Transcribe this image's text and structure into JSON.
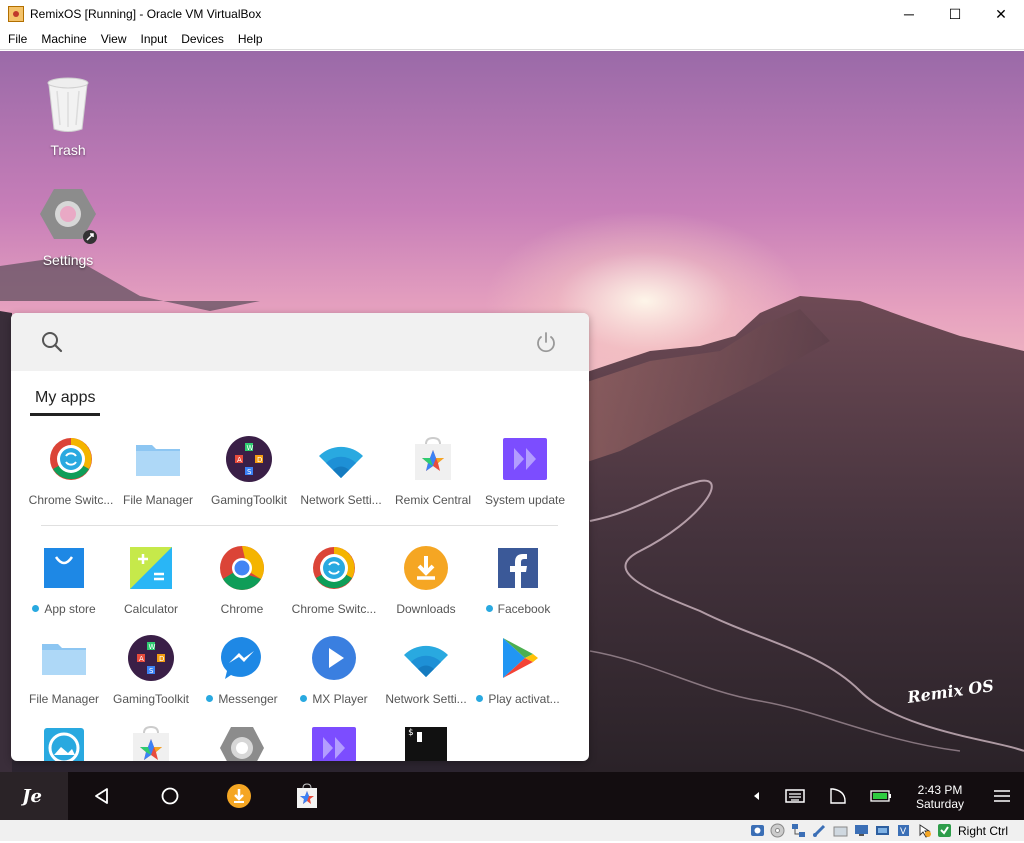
{
  "window": {
    "title": "RemixOS [Running] - Oracle VM VirtualBox",
    "controls": {
      "minimize": "─",
      "maximize": "☐",
      "close": "✕"
    }
  },
  "menu": [
    "File",
    "Machine",
    "View",
    "Input",
    "Devices",
    "Help"
  ],
  "desktop": {
    "icons": [
      {
        "label": "Trash",
        "icon": "trash-icon"
      },
      {
        "label": "Settings",
        "icon": "settings-icon"
      }
    ],
    "watermark": "Remix OS"
  },
  "start_menu": {
    "tab_label": "My apps",
    "pinned_apps": [
      {
        "name": "Chrome Switc...",
        "icon": "chrome-switcher-icon",
        "dot": false
      },
      {
        "name": "File Manager",
        "icon": "folder-icon",
        "dot": false
      },
      {
        "name": "GamingToolkit",
        "icon": "gaming-toolkit-icon",
        "dot": false
      },
      {
        "name": "Network Setti...",
        "icon": "wifi-icon",
        "dot": false
      },
      {
        "name": "Remix Central",
        "icon": "remix-central-icon",
        "dot": false
      },
      {
        "name": "System update",
        "icon": "system-update-icon",
        "dot": false
      }
    ],
    "all_apps": [
      {
        "name": "App store",
        "icon": "app-store-icon",
        "dot": true
      },
      {
        "name": "Calculator",
        "icon": "calculator-icon",
        "dot": false
      },
      {
        "name": "Chrome",
        "icon": "chrome-icon",
        "dot": false
      },
      {
        "name": "Chrome Switc...",
        "icon": "chrome-switcher-icon",
        "dot": false
      },
      {
        "name": "Downloads",
        "icon": "downloads-icon",
        "dot": false
      },
      {
        "name": "Facebook",
        "icon": "facebook-icon",
        "dot": true
      },
      {
        "name": "File Manager",
        "icon": "folder-icon",
        "dot": false
      },
      {
        "name": "GamingToolkit",
        "icon": "gaming-toolkit-icon",
        "dot": false
      },
      {
        "name": "Messenger",
        "icon": "messenger-icon",
        "dot": true
      },
      {
        "name": "MX Player",
        "icon": "mx-player-icon",
        "dot": true
      },
      {
        "name": "Network Setti...",
        "icon": "wifi-icon",
        "dot": false
      },
      {
        "name": "Play activat...",
        "icon": "play-store-icon",
        "dot": true
      }
    ],
    "partial_row_icons": [
      "gallery-icon",
      "remix-central-icon",
      "settings-icon",
      "system-update-icon",
      "terminal-icon"
    ],
    "terminal_prompt": "$"
  },
  "taskbar": {
    "start_label": "Remix",
    "time": "2:43 PM",
    "day": "Saturday"
  },
  "statusbar": {
    "host_key": "Right Ctrl"
  },
  "colors": {
    "taskbar_bg": "#130d10",
    "start_btn_bg": "#2a2327",
    "search_bar_bg": "#f1f1f1",
    "dot_blue": "#29a9e0"
  }
}
